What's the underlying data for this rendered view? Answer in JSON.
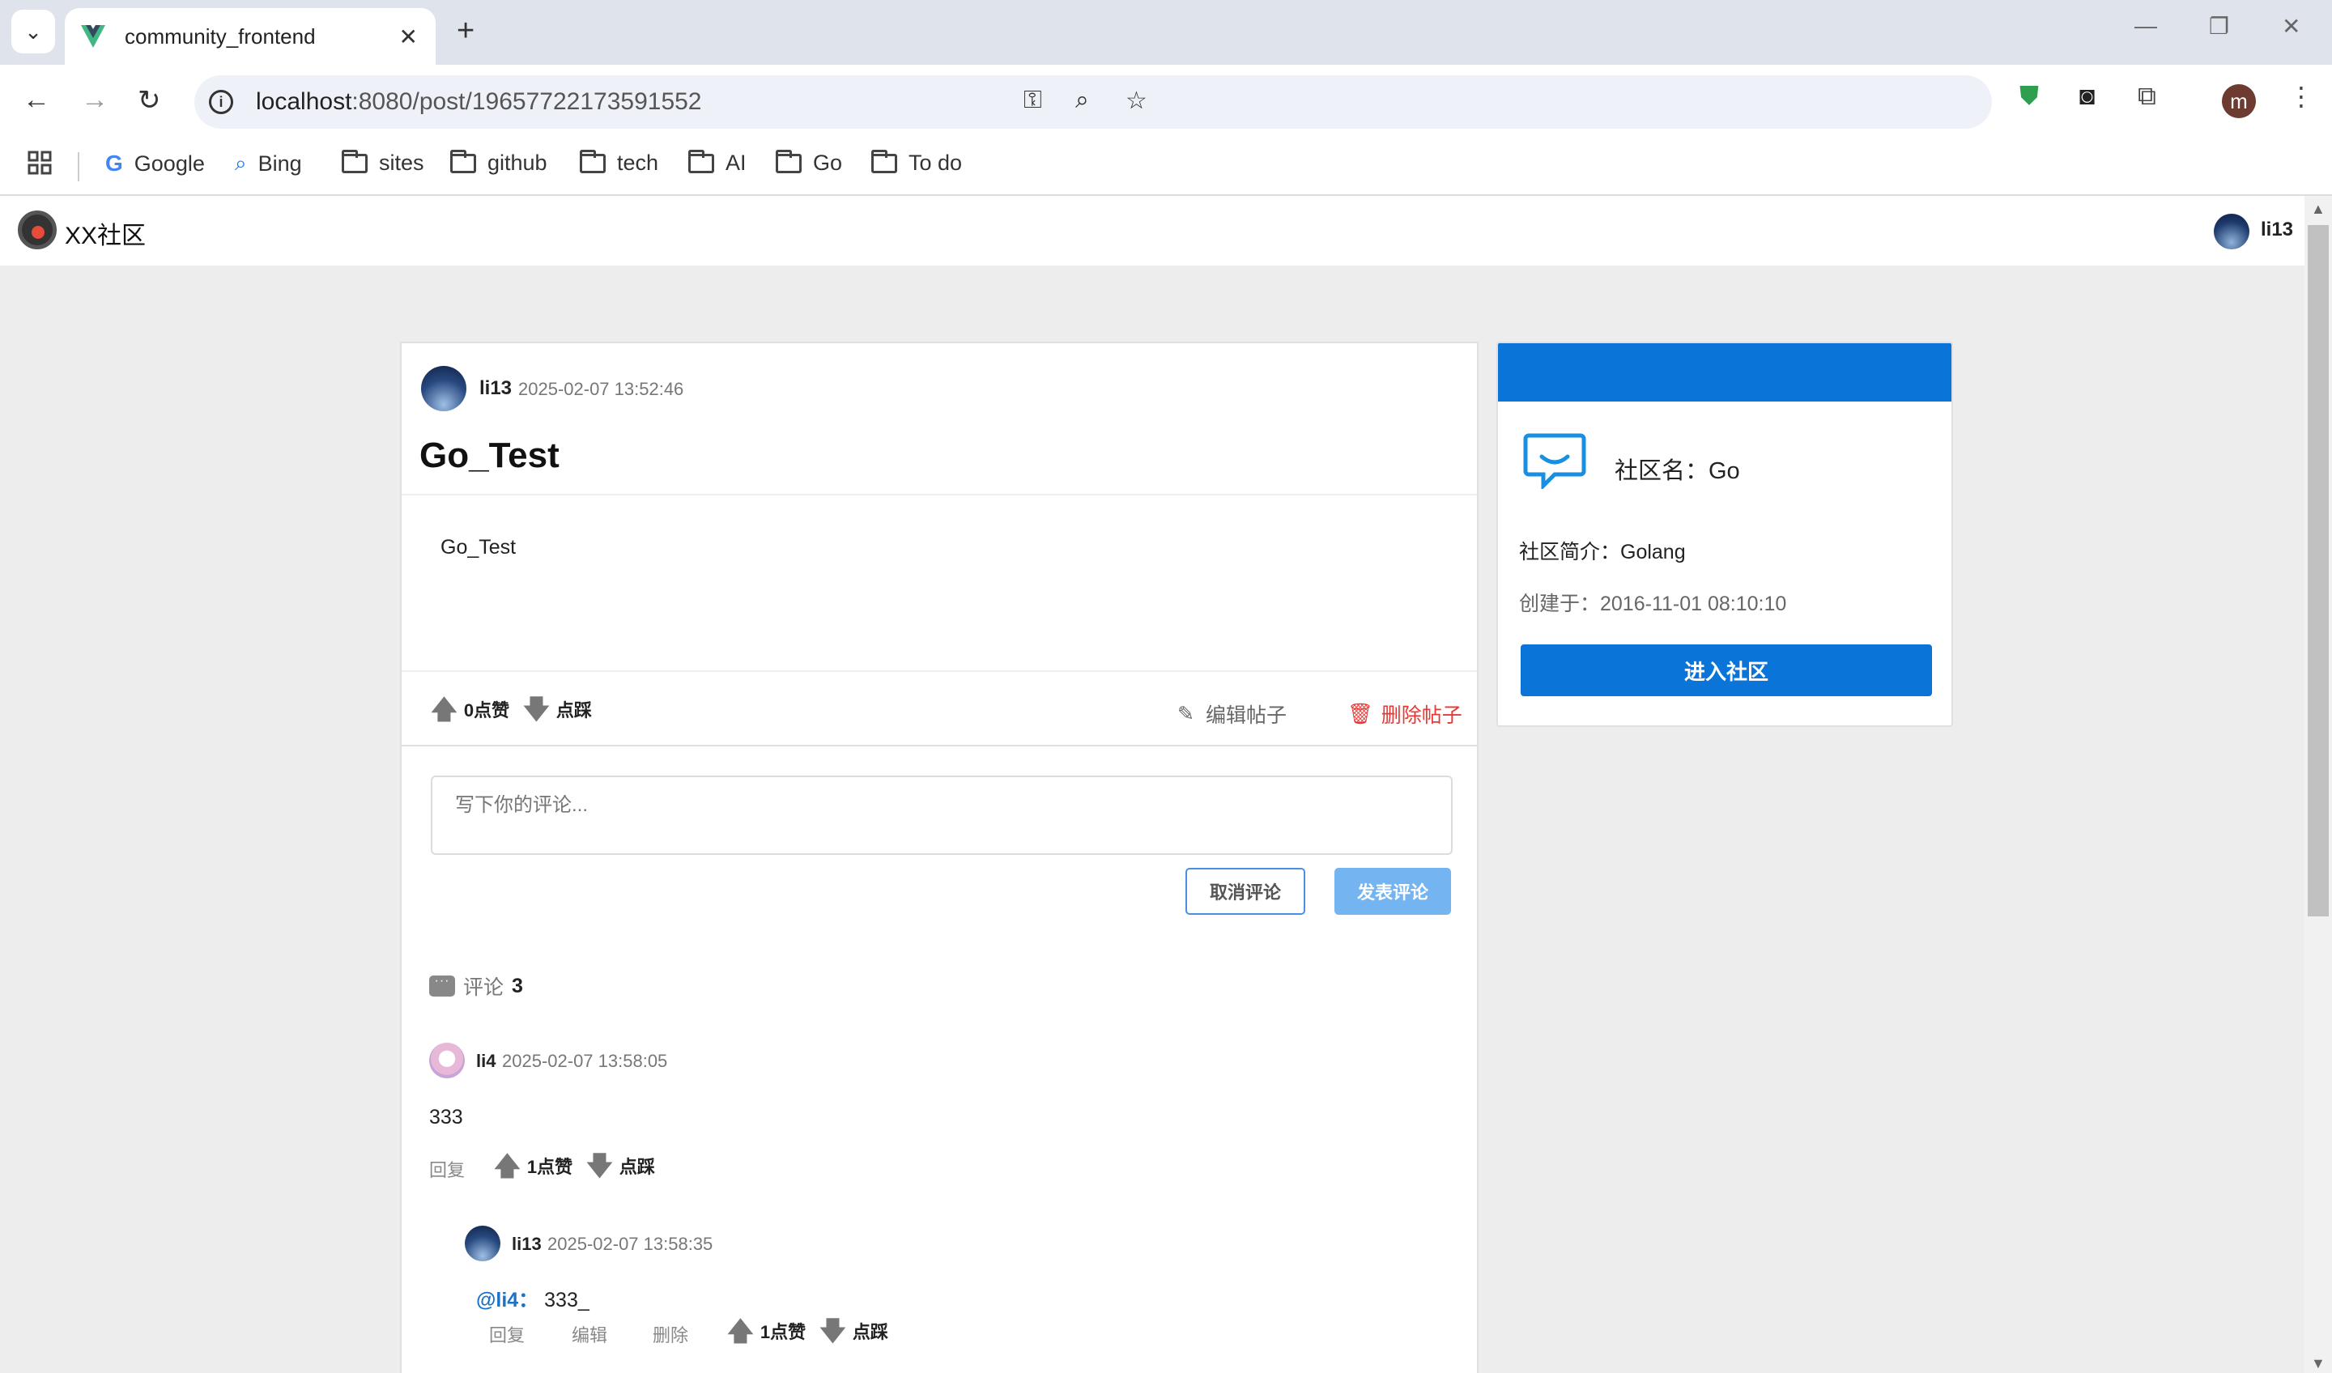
{
  "browser": {
    "tab_title": "community_frontend",
    "url_host": "localhost",
    "url_rest": ":8080/post/19657722173591552",
    "profile_initial": "m",
    "bookmarks": [
      "Google",
      "Bing",
      "sites",
      "github",
      "tech",
      "AI",
      "Go",
      "To do"
    ]
  },
  "site": {
    "name": "XX社区",
    "user": "li13"
  },
  "post": {
    "author": "li13",
    "time": "2025-02-07 13:52:46",
    "title": "Go_Test",
    "body": "Go_Test",
    "like_label": "0点赞",
    "dislike_label": "点踩",
    "edit_label": "编辑帖子",
    "delete_label": "删除帖子"
  },
  "comment_form": {
    "placeholder": "写下你的评论...",
    "cancel_label": "取消评论",
    "submit_label": "发表评论"
  },
  "comments_header": {
    "label": "评论",
    "count": "3"
  },
  "comments": [
    {
      "author": "li4",
      "time": "2025-02-07 13:58:05",
      "text": "333",
      "reply_label": "回复",
      "like_label": "1点赞",
      "dislike_label": "点踩"
    },
    {
      "author": "li13",
      "time": "2025-02-07 13:58:35",
      "mention": "@li4：",
      "text": "333_",
      "reply_label": "回复",
      "edit_label": "编辑",
      "delete_label": "删除",
      "like_label": "1点赞",
      "dislike_label": "点踩"
    }
  ],
  "community": {
    "name_label": "社区名：Go",
    "intro_label": "社区简介：Golang",
    "created_label": "创建于：2016-11-01 08:10:10",
    "enter_label": "进入社区"
  },
  "colors": {
    "brand_blue": "#0a74d9",
    "danger": "#e53935",
    "link": "#1a73c8"
  }
}
